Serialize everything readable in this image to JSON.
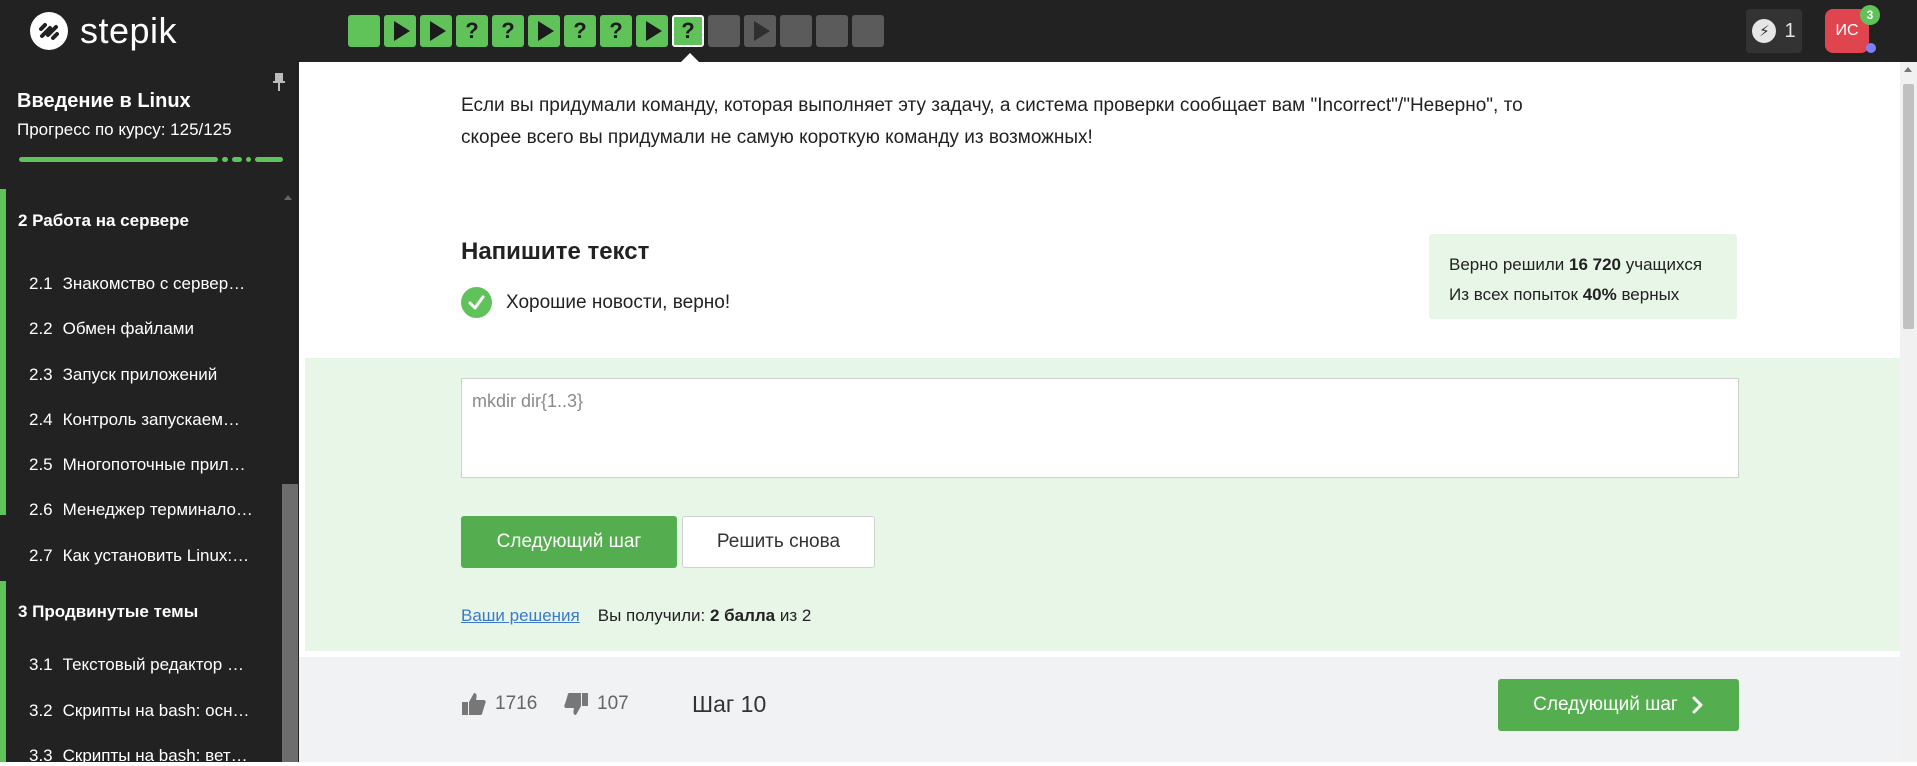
{
  "brand": {
    "name": "stepik"
  },
  "step_nav": [
    {
      "state": "done",
      "kind": "blank"
    },
    {
      "state": "done",
      "kind": "video"
    },
    {
      "state": "done",
      "kind": "video"
    },
    {
      "state": "done",
      "kind": "quiz",
      "label": "?"
    },
    {
      "state": "done",
      "kind": "quiz",
      "label": "?"
    },
    {
      "state": "done",
      "kind": "video"
    },
    {
      "state": "done",
      "kind": "quiz",
      "label": "?"
    },
    {
      "state": "done",
      "kind": "quiz",
      "label": "?"
    },
    {
      "state": "done",
      "kind": "video"
    },
    {
      "state": "current",
      "kind": "quiz",
      "label": "?"
    },
    {
      "state": "todo",
      "kind": "blank"
    },
    {
      "state": "todo",
      "kind": "video"
    },
    {
      "state": "todo",
      "kind": "blank"
    },
    {
      "state": "todo",
      "kind": "blank"
    },
    {
      "state": "todo",
      "kind": "blank"
    }
  ],
  "header": {
    "energy_count": "1",
    "avatar_initials": "ИС",
    "notification_count": "3"
  },
  "sidebar": {
    "course_title": "Введение в Linux",
    "progress_label": "Прогресс по курсу:  125/125",
    "modules": [
      {
        "title": "2  Работа на сервере",
        "lessons": [
          {
            "num": "2.1",
            "title": "Знакомство с сервер…"
          },
          {
            "num": "2.2",
            "title": "Обмен файлами"
          },
          {
            "num": "2.3",
            "title": "Запуск приложений"
          },
          {
            "num": "2.4",
            "title": "Контроль запускаем…"
          },
          {
            "num": "2.5",
            "title": "Многопоточные прил…"
          },
          {
            "num": "2.6",
            "title": "Менеджер терминало…"
          },
          {
            "num": "2.7",
            "title": "Как установить Linux:…"
          }
        ]
      },
      {
        "title": "3  Продвинутые темы",
        "lessons": [
          {
            "num": "3.1",
            "title": "Текстовый редактор …"
          },
          {
            "num": "3.2",
            "title": "Скрипты на bash: осн…"
          },
          {
            "num": "3.3",
            "title": "Скрипты на bash: вет…"
          }
        ]
      }
    ]
  },
  "main": {
    "instruction": "Если вы придумали команду, которая выполняет эту задачу, а система проверки сообщает вам \"Incorrect\"/\"Неверно\", то скорее всего вы придумали не самую короткую команду из возможных!",
    "section_heading": "Напишите текст",
    "success_message": "Хорошие новости, верно!",
    "stats": {
      "solved_prefix": "Верно решили ",
      "solved_count": "16 720",
      "solved_suffix": " учащихся",
      "attempts_prefix": "Из всех попыток ",
      "attempts_percent": "40%",
      "attempts_suffix": " верных"
    },
    "answer_value": "mkdir dir{1..3}",
    "next_button": "Следующий шаг",
    "retry_button": "Решить снова",
    "solutions_link": "Ваши решения",
    "score_prefix": "Вы получили: ",
    "score_value": "2 балла",
    "score_suffix": " из 2"
  },
  "footer": {
    "likes": "1716",
    "dislikes": "107",
    "step_label": "Шаг 10",
    "next_button": "Следующий шаг"
  },
  "colors": {
    "accent_green": "#54ad4f",
    "step_done": "#5fc35a",
    "topbar": "#222222",
    "success_bg": "#e7f6e7",
    "avatar": "#e0454f",
    "link": "#3b7ac9"
  }
}
